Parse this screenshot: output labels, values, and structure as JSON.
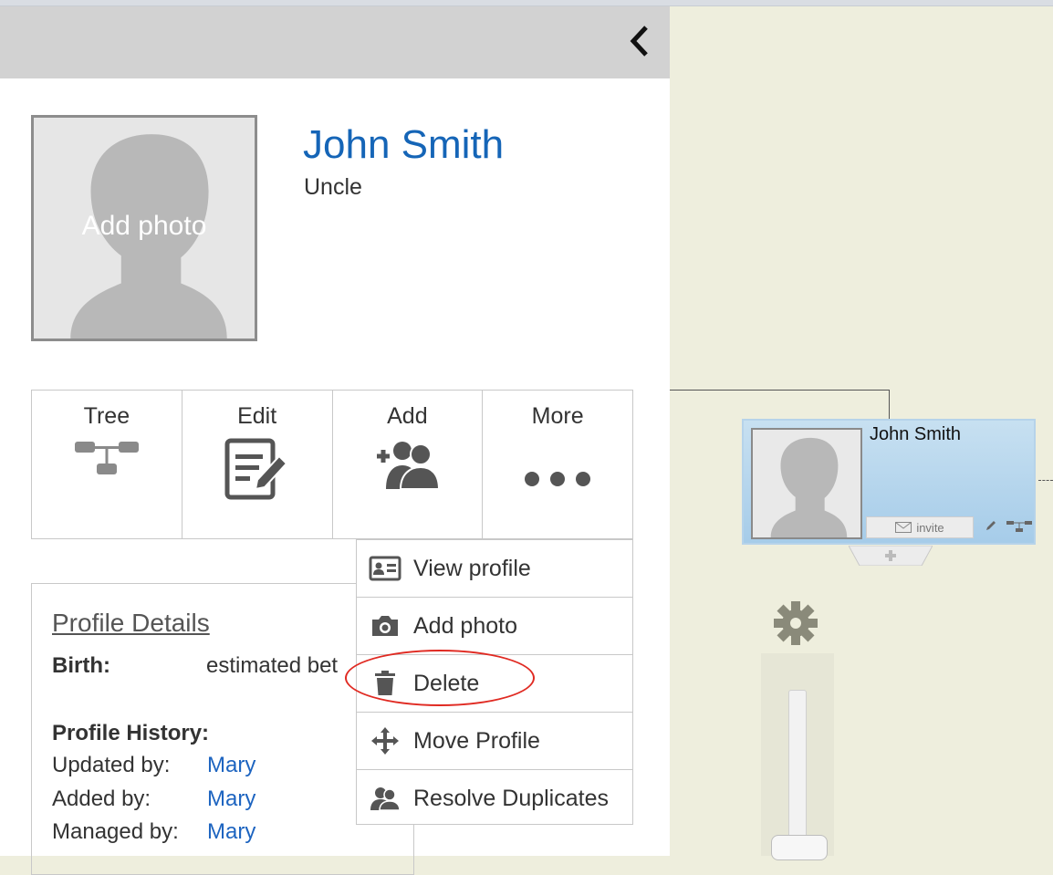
{
  "panel": {
    "back_icon": "chevron-left-icon",
    "photo_label": "Add photo",
    "name": "John Smith",
    "relation": "Uncle"
  },
  "actions": [
    {
      "label": "Tree",
      "icon": "tree-icon"
    },
    {
      "label": "Edit",
      "icon": "edit-icon"
    },
    {
      "label": "Add",
      "icon": "add-person-icon"
    },
    {
      "label": "More",
      "icon": "ellipsis-icon"
    }
  ],
  "details": {
    "title": "Profile Details",
    "birth_label": "Birth:",
    "birth_value": "estimated bet",
    "history_title": "Profile History:",
    "history": [
      {
        "label": "Updated by:",
        "who": "Mary"
      },
      {
        "label": "Added by:",
        "who": "Mary"
      },
      {
        "label": "Managed by:",
        "who": "Mary"
      }
    ]
  },
  "menu": {
    "items": [
      {
        "label": "View profile",
        "icon": "id-card-icon"
      },
      {
        "label": "Add photo",
        "icon": "camera-icon"
      },
      {
        "label": "Delete",
        "icon": "trash-icon"
      },
      {
        "label": "Move Profile",
        "icon": "move-icon"
      },
      {
        "label": "Resolve Duplicates",
        "icon": "duplicates-icon"
      }
    ]
  },
  "tree_node": {
    "name": "John Smith",
    "invite_label": "invite"
  },
  "colors": {
    "name_blue": "#1565b7",
    "link_blue": "#1d64c0",
    "highlight_red": "#e02a22",
    "canvas_bg": "#eeeedd",
    "node_blue": "#a6cce9"
  }
}
